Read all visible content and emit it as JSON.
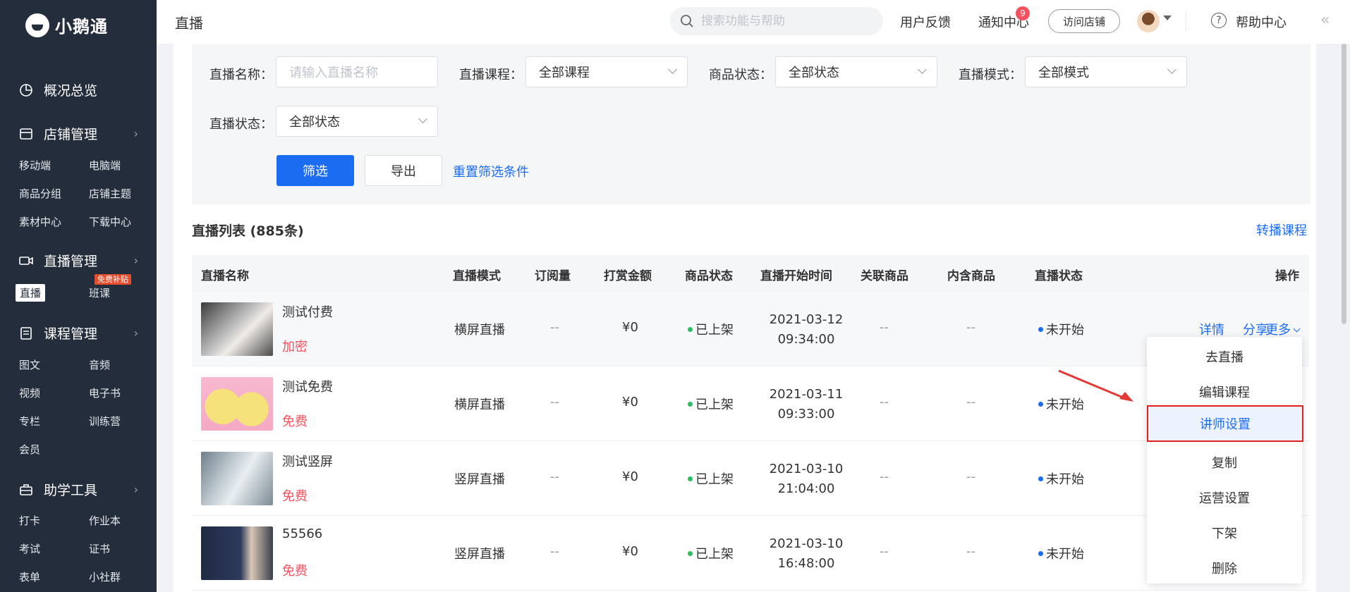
{
  "sidebar": {
    "brand": "小鹅通",
    "overview": "概况总览",
    "shop": {
      "title": "店铺管理",
      "items": [
        "移动端",
        "电脑端",
        "商品分组",
        "店铺主题",
        "素材中心",
        "下载中心"
      ]
    },
    "live": {
      "title": "直播管理",
      "items": [
        "直播",
        "班课"
      ],
      "badge": "免费补贴"
    },
    "course": {
      "title": "课程管理",
      "items": [
        "图文",
        "音频",
        "视频",
        "电子书",
        "专栏",
        "训练营",
        "会员"
      ]
    },
    "tools": {
      "title": "助学工具",
      "items": [
        "打卡",
        "作业本",
        "考试",
        "证书",
        "表单",
        "小社群"
      ]
    }
  },
  "topbar": {
    "title": "直播",
    "search_placeholder": "搜索功能与帮助",
    "feedback": "用户反馈",
    "notify": "通知中心",
    "notify_count": "9",
    "visit_shop": "访问店铺",
    "help": "帮助中心"
  },
  "filters": {
    "name_label": "直播名称：",
    "name_placeholder": "请输入直播名称",
    "course_label": "直播课程：",
    "course_value": "全部课程",
    "goods_label": "商品状态：",
    "goods_value": "全部状态",
    "mode_label": "直播模式：",
    "mode_value": "全部模式",
    "status_label": "直播状态：",
    "status_value": "全部状态",
    "filter_btn": "筛选",
    "export_btn": "导出",
    "reset_link": "重置筛选条件"
  },
  "list": {
    "title": "直播列表 (885条)",
    "relay_link": "转播课程",
    "columns": [
      "直播名称",
      "直播模式",
      "订阅量",
      "打赏金额",
      "商品状态",
      "直播开始时间",
      "关联商品",
      "内含商品",
      "直播状态",
      "操作"
    ],
    "rows": [
      {
        "name": "测试付费",
        "tag": "加密",
        "mode": "横屏直播",
        "subs": "--",
        "reward": "¥0",
        "goods": "已上架",
        "date": "2021-03-12",
        "time": "09:34:00",
        "related": "--",
        "contained": "--",
        "status": "未开始"
      },
      {
        "name": "测试免费",
        "tag": "免费",
        "mode": "横屏直播",
        "subs": "--",
        "reward": "¥0",
        "goods": "已上架",
        "date": "2021-03-11",
        "time": "09:33:00",
        "related": "--",
        "contained": "--",
        "status": "未开始"
      },
      {
        "name": "测试竖屏",
        "tag": "免费",
        "mode": "竖屏直播",
        "subs": "--",
        "reward": "¥0",
        "goods": "已上架",
        "date": "2021-03-10",
        "time": "21:04:00",
        "related": "--",
        "contained": "--",
        "status": "未开始"
      },
      {
        "name": "55566",
        "tag": "免费",
        "mode": "竖屏直播",
        "subs": "--",
        "reward": "¥0",
        "goods": "已上架",
        "date": "2021-03-10",
        "time": "16:48:00",
        "related": "--",
        "contained": "--",
        "status": "未开始"
      }
    ],
    "ops": {
      "detail": "详情",
      "share": "分享",
      "more": "更多"
    }
  },
  "dropdown": [
    "去直播",
    "编辑课程",
    "讲师设置",
    "复制",
    "运营设置",
    "下架",
    "删除"
  ],
  "colors": {
    "primary": "#1c6cf2",
    "sidebar": "#232d3b",
    "danger": "#f5515f",
    "on_shelf": "#2dbf5b",
    "not_started": "#1c6cf2",
    "highlight_border": "#e02020"
  }
}
